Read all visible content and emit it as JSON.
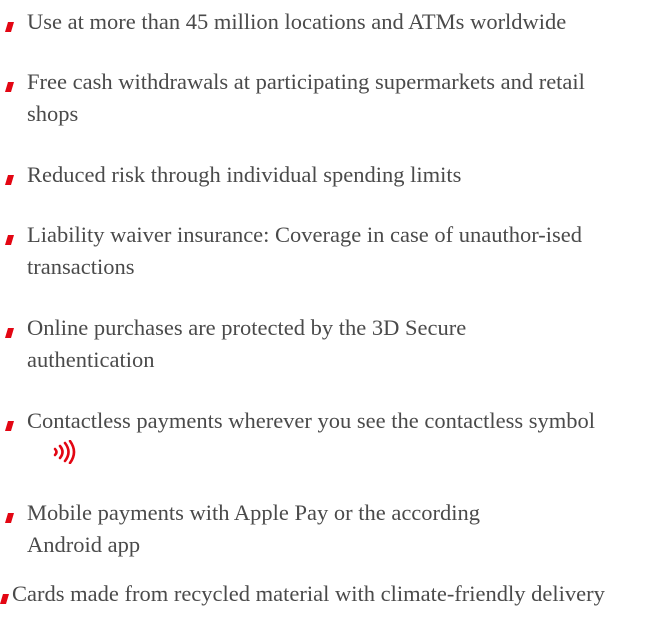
{
  "accent_color": "#e30613",
  "text_color": "#4a4a4a",
  "features": [
    {
      "text": "Use at more than 45 million locations and ATMs worldwide"
    },
    {
      "text": "Free cash withdrawals at participating supermarkets and retail shops"
    },
    {
      "text": "Reduced risk through individual spending limits"
    },
    {
      "text": "Liability waiver insurance: Coverage in case of unauthor-ised transactions"
    },
    {
      "text": "Online purchases are protected by the 3D Secure authentication"
    },
    {
      "text": "Contactless payments wherever you see the contactless symbol",
      "icon": "contactless-symbol-icon"
    },
    {
      "text": "Mobile payments with Apple Pay or the according Android app"
    },
    {
      "text": "Cards made from recycled material with climate-friendly delivery"
    }
  ]
}
